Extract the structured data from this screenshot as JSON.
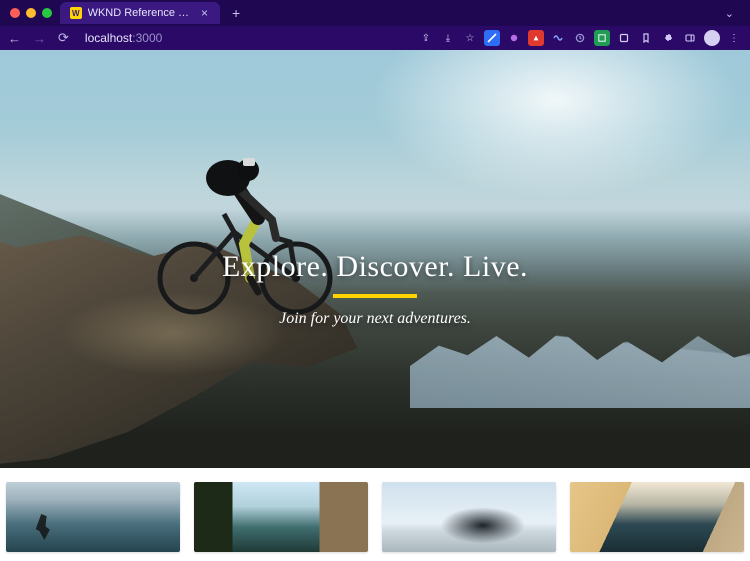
{
  "browser": {
    "tab": {
      "favicon_letter": "W",
      "title": "WKND Reference Site",
      "close_glyph": "×"
    },
    "new_tab_glyph": "+",
    "address": {
      "host": "localhost",
      "port": ":3000"
    },
    "nav": {
      "back": "←",
      "forward": "→",
      "reload": "⟳"
    },
    "actions": {
      "share": "⇪",
      "download": "⤓",
      "star": "☆",
      "menu": "⋮"
    }
  },
  "page": {
    "hero": {
      "title": "Explore. Discover. Live.",
      "subtitle": "Join for your next adventures."
    },
    "cards": [
      {
        "name": "surf"
      },
      {
        "name": "canyon-river"
      },
      {
        "name": "ski-touring"
      },
      {
        "name": "coastline"
      }
    ]
  },
  "colors": {
    "accent": "#ffd400",
    "chrome_bg": "#2a0a66"
  }
}
